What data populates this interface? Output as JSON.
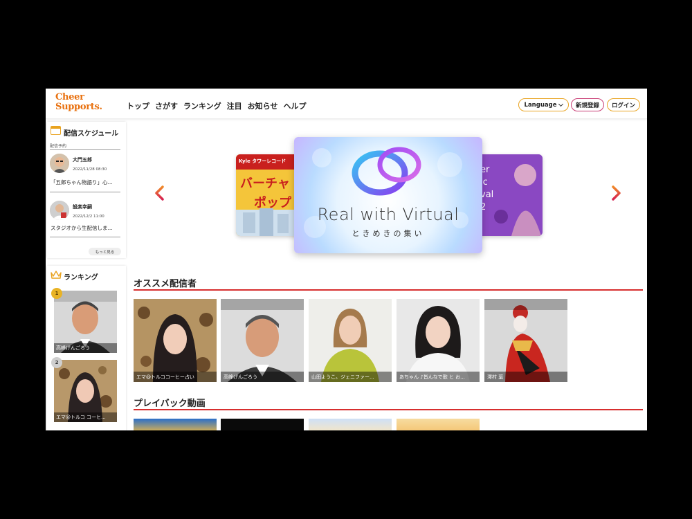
{
  "header": {
    "logo_line1": "Cheer",
    "logo_line2": "Supports.",
    "nav": [
      "トップ",
      "さがす",
      "ランキング",
      "注目",
      "お知らせ",
      "ヘルプ"
    ],
    "language_label": "Language",
    "register_label": "新規登録",
    "login_label": "ログイン"
  },
  "sidebar": {
    "schedule": {
      "title": "配信スケジュール",
      "subtitle": "配信予約",
      "items": [
        {
          "name": "大門五郎",
          "date": "2022/11/28 08:30",
          "text": "「五郎ちゃん物語り」心..."
        },
        {
          "name": "設楽幸嗣",
          "date": "2022/12/2 11:00",
          "text": "スタジオから生配信しま..."
        }
      ],
      "more_label": "もっと見る"
    },
    "ranking": {
      "title": "ランキング",
      "items": [
        {
          "rank": "1",
          "name": "高峰げんごろう"
        },
        {
          "rank": "2",
          "name": "エマ@トルコ コーヒ..."
        }
      ]
    }
  },
  "carousel": {
    "left_slide_tag": "Kyle タワーレコード",
    "left_slide_text1": "バーチャ",
    "left_slide_text2": "ポップ",
    "main_title": "Real with Virtual",
    "main_subtitle": "ときめきの集い",
    "right_slide_text": "er\nic\nval\n2"
  },
  "recommended": {
    "title": "オススメ配信者",
    "items": [
      {
        "caption": "エマ@トルココーヒー占い"
      },
      {
        "caption": "高峰げんごろう"
      },
      {
        "caption": "山田ようこ。ジェニファー..."
      },
      {
        "caption": "あちゃん ♪皆んなで歌 と お..."
      },
      {
        "caption": "澤村 葉"
      }
    ]
  },
  "playback": {
    "title": "プレイバック動画"
  },
  "colors": {
    "brand_orange": "#e8700e",
    "accent_red": "#d72e2e",
    "border_gold": "#e9a320",
    "border_pink": "#c83b73"
  }
}
